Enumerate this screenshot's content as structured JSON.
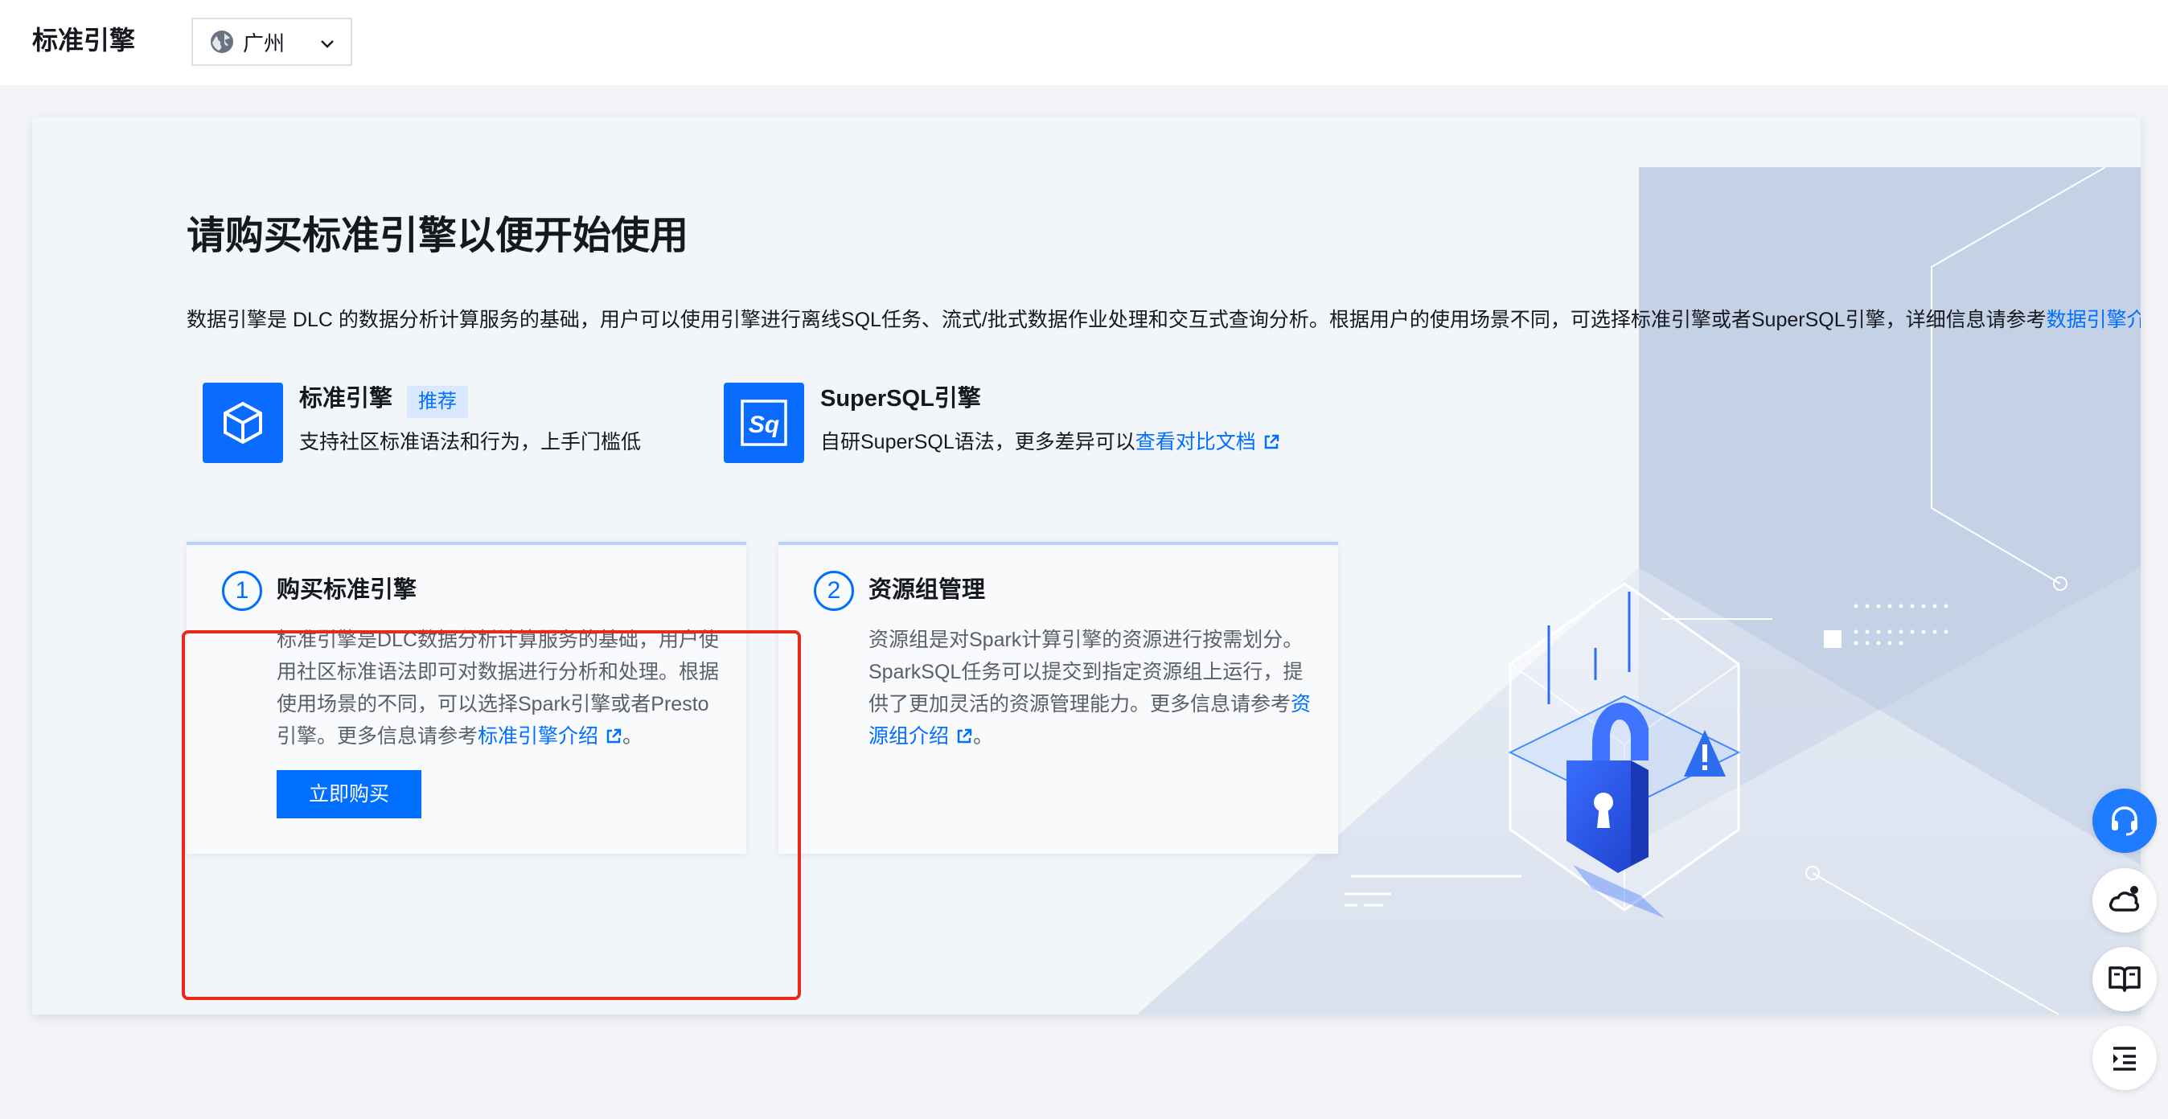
{
  "topbar": {
    "title": "标准引擎",
    "region": {
      "value": "广州"
    }
  },
  "main": {
    "title": "请购买标准引擎以便开始使用",
    "intro": {
      "text": "数据引擎是 DLC 的数据分析计算服务的基础，用户可以使用引擎进行离线SQL任务、流式/批式数据作业处理和交互式查询分析。根据用户的使用场景不同，可选择标准引擎或者SuperSQL引擎，详细信息请参考",
      "link": "数据引擎介绍",
      "suffix": "。"
    },
    "engines": [
      {
        "name": "标准引擎",
        "tag": "推荐",
        "desc": "支持社区标准语法和行为，上手门槛低",
        "icon": "cube-icon"
      },
      {
        "name": "SuperSQL引擎",
        "desc_prefix": "自研SuperSQL语法，更多差异可以",
        "desc_link": "查看对比文档",
        "icon": "sq-logo-icon"
      }
    ],
    "steps": [
      {
        "number": "1",
        "title": "购买标准引擎",
        "body": "标准引擎是DLC数据分析计算服务的基础，用户使用社区标准语法即可对数据进行分析和处理。根据使用场景的不同，可以选择Spark引擎或者Presto引擎。更多信息请参考",
        "link": "标准引擎介绍",
        "suffix": "。",
        "button": "立即购买"
      },
      {
        "number": "2",
        "title": "资源组管理",
        "body": "资源组是对Spark计算引擎的资源进行按需划分。SparkSQL任务可以提交到指定资源组上运行，提供了更加灵活的资源管理能力。更多信息请参考",
        "link": "资源组介绍",
        "suffix": "。"
      }
    ]
  },
  "floating": [
    "headset-icon",
    "cloud-alert-icon",
    "book-icon",
    "collapse-list-icon"
  ],
  "colors": {
    "accent": "#006eff",
    "highlight": "#e8291c",
    "tag_bg": "#d9e8ff"
  }
}
